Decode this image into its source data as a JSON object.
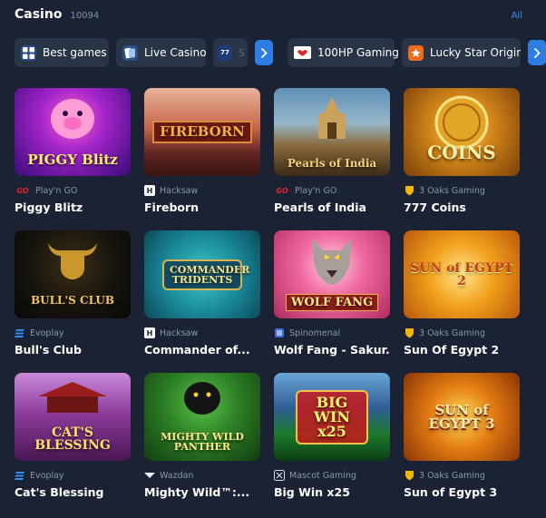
{
  "header": {
    "title": "Casino",
    "count": "10094",
    "all_label": "All"
  },
  "filters": [
    {
      "label": "Best games",
      "icon": "grid-icon"
    },
    {
      "label": "Live Casino",
      "icon": "cards-icon"
    },
    {
      "label": "S",
      "icon": "slot-777-icon"
    },
    {
      "label": "100HP Gaming",
      "icon": "100hp-logo-icon"
    },
    {
      "label": "Lucky Star Original",
      "icon": "lucky-star-icon"
    }
  ],
  "games": [
    {
      "name": "Piggy Blitz",
      "provider": "Play'n GO",
      "provider_icon": "playngo-icon",
      "art": "PIGGY Blitz"
    },
    {
      "name": "Fireborn",
      "provider": "Hacksaw",
      "provider_icon": "hacksaw-icon",
      "art": "FIREBORN"
    },
    {
      "name": "Pearls of India",
      "provider": "Play'n GO",
      "provider_icon": "playngo-icon",
      "art": "Pearls of India"
    },
    {
      "name": "777 Coins",
      "provider": "3 Oaks Gaming",
      "provider_icon": "3oaks-icon",
      "art": "COINS"
    },
    {
      "name": "Bull's Club",
      "provider": "Evoplay",
      "provider_icon": "evoplay-icon",
      "art": "BULL'S CLUB"
    },
    {
      "name": "Commander of...",
      "provider": "Hacksaw",
      "provider_icon": "hacksaw-icon",
      "art": "COMMANDER TRIDENTS"
    },
    {
      "name": "Wolf Fang - Sakur...",
      "provider": "Spinomenal",
      "provider_icon": "spinomenal-icon",
      "art": "WOLF FANG"
    },
    {
      "name": "Sun Of Egypt 2",
      "provider": "3 Oaks Gaming",
      "provider_icon": "3oaks-icon",
      "art": "SUN of EGYPT 2"
    },
    {
      "name": "Cat's Blessing",
      "provider": "Evoplay",
      "provider_icon": "evoplay-icon",
      "art": "CAT'S BLESSING"
    },
    {
      "name": "Mighty Wild™:...",
      "provider": "Wazdan",
      "provider_icon": "wazdan-icon",
      "art": "MIGHTY WILD PANTHER"
    },
    {
      "name": "Big Win x25",
      "provider": "Mascot Gaming",
      "provider_icon": "mascot-icon",
      "art": "BIG WIN x25"
    },
    {
      "name": "Sun of Egypt 3",
      "provider": "3 Oaks Gaming",
      "provider_icon": "3oaks-icon",
      "art": "SUN of EGYPT 3"
    }
  ],
  "colors": {
    "background": "#1a2233",
    "chip": "#2a3447",
    "accent": "#2d7de3",
    "muted": "#8e97aa"
  }
}
